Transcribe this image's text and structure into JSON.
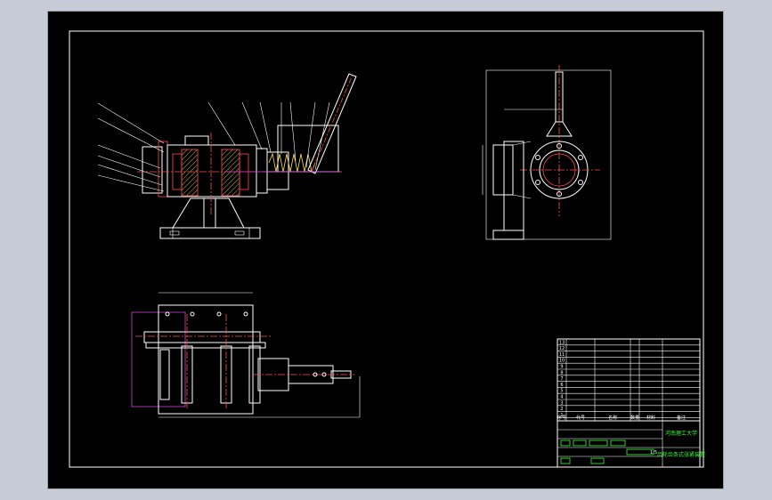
{
  "title_block": {
    "university": "河南理工大学",
    "drawing_title": "齿轮齿条式张紧装置",
    "headers": [
      "序号",
      "代号",
      "名称",
      "数量",
      "材料",
      "备注"
    ],
    "row_numbers": [
      "13",
      "12",
      "11",
      "10",
      "9",
      "8",
      "7",
      "6",
      "5",
      "4",
      "3",
      "2",
      "1"
    ],
    "scale": "1:5"
  },
  "colors": {
    "background": "#000000",
    "outline": "#ffffff",
    "section_lines": "#ff4d4d",
    "hatch": "#ffe14d",
    "dimension": "#d040d0",
    "title_text": "#39ff39"
  }
}
